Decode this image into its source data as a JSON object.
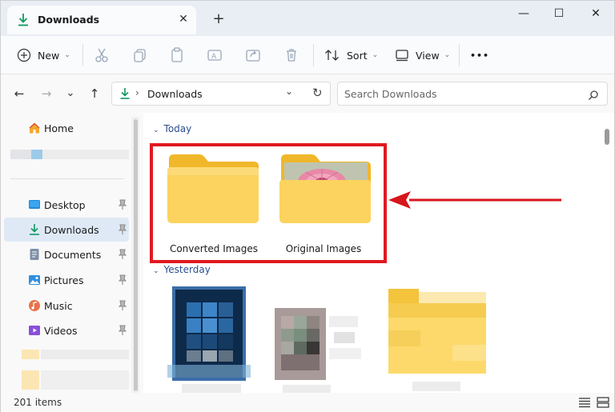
{
  "tab": {
    "title": "Downloads",
    "close": "✕",
    "new_tab": "+"
  },
  "window_controls": {
    "minimize": "—",
    "maximize": "☐",
    "close": "✕"
  },
  "toolbar": {
    "new_label": "New",
    "sort_label": "Sort",
    "view_label": "View",
    "more_label": "•••",
    "icons": [
      "add-icon",
      "cut-icon",
      "copy-icon",
      "paste-icon",
      "rename-icon",
      "share-icon",
      "delete-icon",
      "sort-icon",
      "view-icon",
      "more-icon"
    ]
  },
  "nav": {
    "back": "←",
    "forward": "→",
    "recent": "⌄",
    "up": "↑"
  },
  "address": {
    "separator": "›",
    "location": "Downloads",
    "refresh": "↻"
  },
  "search": {
    "placeholder": "Search Downloads"
  },
  "sidebar": {
    "home": "Home",
    "items": [
      {
        "label": "Desktop",
        "icon": "desktop-icon",
        "pinned": true
      },
      {
        "label": "Downloads",
        "icon": "downloads-icon",
        "pinned": true,
        "active": true
      },
      {
        "label": "Documents",
        "icon": "documents-icon",
        "pinned": true
      },
      {
        "label": "Pictures",
        "icon": "pictures-icon",
        "pinned": true
      },
      {
        "label": "Music",
        "icon": "music-icon",
        "pinned": true
      },
      {
        "label": "Videos",
        "icon": "videos-icon",
        "pinned": true
      }
    ]
  },
  "groups": {
    "today": "Today",
    "yesterday": "Yesterday"
  },
  "folders": [
    {
      "name": "Converted Images"
    },
    {
      "name": "Original Images"
    }
  ],
  "status": {
    "item_count": "201 items"
  },
  "colors": {
    "accent": "#0f7b4f",
    "highlight": "#e0191f",
    "folder": "#f5c443",
    "group_text": "#2a4d8f"
  }
}
